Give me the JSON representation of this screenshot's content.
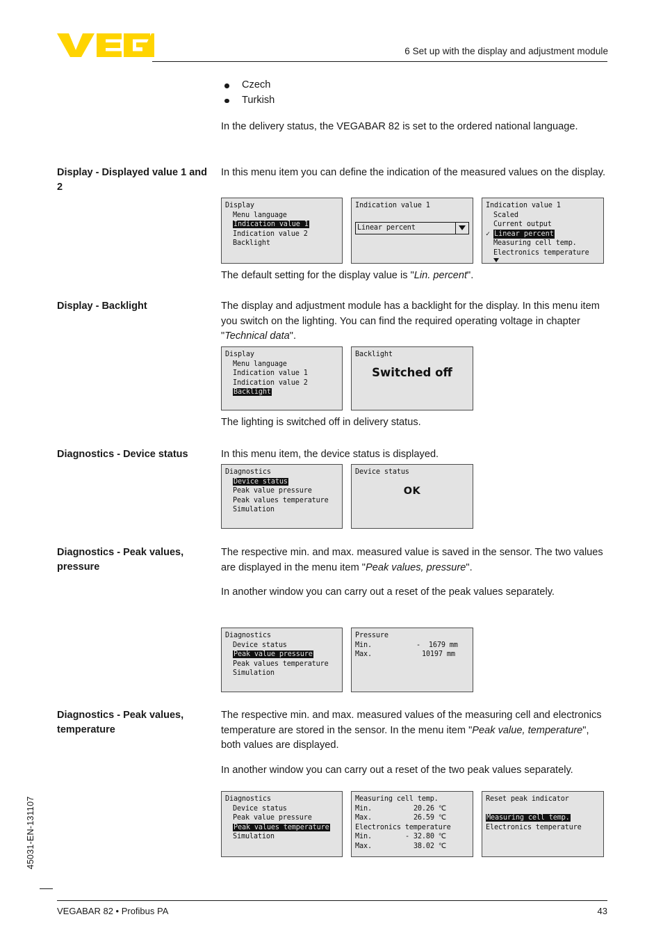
{
  "header": {
    "logo_text": "VEGA",
    "logo_color": "#ffd400",
    "section_title": "6 Set up with the display and adjustment module"
  },
  "languages": [
    "Czech",
    "Turkish"
  ],
  "intro": {
    "paragraph": "In the delivery status, the VEGABAR 82 is set to the ordered national language."
  },
  "sections": [
    {
      "label": "Display - Displayed value 1 and 2",
      "intro": "In this menu item you can define the indication of the measured values on the display.",
      "outro_prefix": "The default setting for the display value is \"",
      "outro_italic": "Lin. percent",
      "outro_suffix": "\"."
    },
    {
      "label": "Display - Backlight",
      "body_part1": "The display and adjustment module has a backlight for the display. In this menu item you switch on the lighting. You can find the required operating voltage in chapter  \"",
      "body_italic": "Technical data",
      "body_part2": "\".",
      "outro": "The lighting is switched off in delivery status."
    },
    {
      "label": "Diagnostics - Device status",
      "intro": "In this menu item, the device status is displayed."
    },
    {
      "label": "Diagnostics - Peak values, pressure",
      "p1_prefix": "The respective min. and max. measured value is saved in the sensor. The two values are displayed in the menu item \"",
      "p1_italic": "Peak values, pressure",
      "p1_suffix": "\".",
      "p2": "In another window you can carry out a reset of the peak values separately."
    },
    {
      "label": "Diagnostics - Peak values, temperature",
      "p1_prefix": "The respective min. and max. measured values of the measuring cell and electronics temperature are stored in the sensor. In the menu item \"",
      "p1_italic": "Peak value, temperature",
      "p1_suffix": "\", both values are displayed.",
      "p2": "In another window you can carry out a reset of the two peak values separately."
    }
  ],
  "screens": {
    "display_menu_ind1": {
      "title": "Display",
      "items": [
        "Menu language",
        "Indication value 1",
        "Indication value 2",
        "Backlight"
      ],
      "selected": "Indication value 1"
    },
    "indication_value_1_dropdown": {
      "title": "Indication value 1",
      "value": "Linear percent",
      "arrow_icon": "chevron-down-icon"
    },
    "indication_value_1_list": {
      "title": "Indication value 1",
      "items": [
        "Scaled",
        "Current output",
        "Linear percent",
        "Measuring cell temp.",
        "Electronics temperature"
      ],
      "selected": "Linear percent",
      "checked": "Linear percent",
      "more_icon": "scroll-down-icon"
    },
    "display_menu_backlight": {
      "title": "Display",
      "items": [
        "Menu language",
        "Indication value 1",
        "Indication value 2",
        "Backlight"
      ],
      "selected": "Backlight"
    },
    "backlight_value": {
      "title": "Backlight",
      "value": "Switched off"
    },
    "diagnostics_menu_device_status": {
      "title": "Diagnostics",
      "items": [
        "Device status",
        "Peak value pressure",
        "Peak values temperature",
        "Simulation"
      ],
      "selected": "Device status"
    },
    "device_status_value": {
      "title": "Device status",
      "value": "OK"
    },
    "diagnostics_menu_peak_pressure": {
      "title": "Diagnostics",
      "items": [
        "Device status",
        "Peak value pressure",
        "Peak values temperature",
        "Simulation"
      ],
      "selected": "Peak value pressure"
    },
    "pressure_peaks": {
      "title": "Pressure",
      "rows": [
        {
          "label": "Min.",
          "value": "-  1679 mm"
        },
        {
          "label": "Max.",
          "value": "10197 mm"
        }
      ]
    },
    "diagnostics_menu_peak_temperature": {
      "title": "Diagnostics",
      "items": [
        "Device status",
        "Peak value pressure",
        "Peak values temperature",
        "Simulation"
      ],
      "selected": "Peak values temperature"
    },
    "temperature_peaks": {
      "title": "Measuring cell temp.",
      "cell_min_label": "Min.",
      "cell_min_value": "20.26 ℃",
      "cell_max_label": "Max.",
      "cell_max_value": "26.59 ℃",
      "electronics_title": "Electronics temperature",
      "el_min_label": "Min.",
      "el_min_value": "- 32.80 ℃",
      "el_max_label": "Max.",
      "el_max_value": "38.02 ℃"
    },
    "reset_peak_indicator": {
      "title": "Reset peak indicator",
      "items": [
        "Measuring cell temp.",
        "Electronics temperature"
      ],
      "selected": "Measuring cell temp."
    }
  },
  "footer": {
    "left": "VEGABAR 82 • Profibus PA",
    "page_number": "43",
    "doc_code": "45031-EN-131107"
  }
}
